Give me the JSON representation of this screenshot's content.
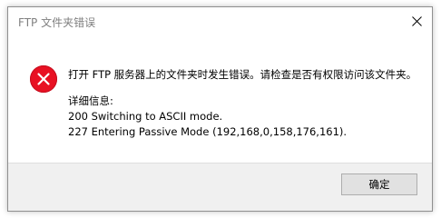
{
  "window": {
    "title": "FTP 文件夹错误"
  },
  "message": {
    "main": "打开 FTP 服务器上的文件夹时发生错误。请检查是否有权限访问该文件夹。",
    "details_header": "详细信息:",
    "details_lines": [
      "200 Switching to ASCII mode.",
      "227 Entering Passive Mode (192,168,0,158,176,161)."
    ]
  },
  "buttons": {
    "ok_label": "确定"
  },
  "icons": {
    "error": "error-icon",
    "close": "close-icon"
  },
  "colors": {
    "error_red": "#e81123",
    "footer_bg": "#f0f0f0",
    "title_text": "#808080"
  }
}
